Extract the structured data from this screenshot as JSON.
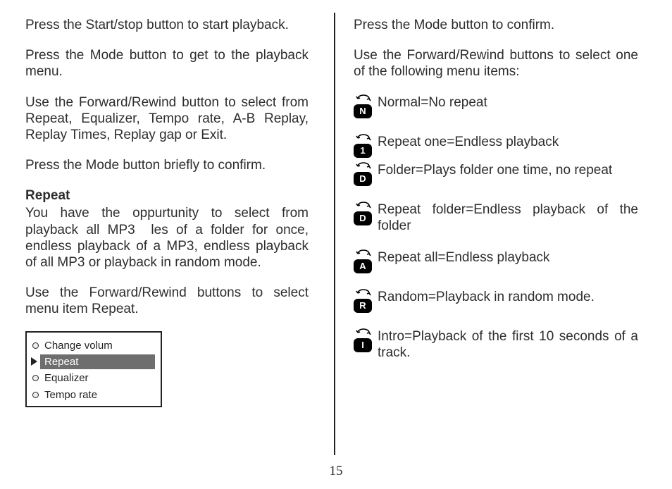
{
  "pageNumber": "15",
  "left": {
    "p1": "Press the Start/stop button to start playback.",
    "p2": "Press the Mode button to get to the playback menu.",
    "p3": "Use the Forward/Rewind button to select from Repeat, Equalizer, Tempo rate, A-B Replay, Replay Times, Replay gap or Exit.",
    "p4": "Press the Mode button briefly to confirm.",
    "heading": "Repeat",
    "p5": "You have the oppurtunity to select from playback all MP3  les of a folder for once, endless playback of a MP3, endless playback of all MP3 or playback in random mode.",
    "p6": "Use the Forward/Rewind buttons to select menu item Repeat.",
    "menu": {
      "item1": "Change volum",
      "item2": "Repeat",
      "item3": "Equalizer",
      "item4": "Tempo rate",
      "selectedIndex": 1
    }
  },
  "right": {
    "p1": "Press the Mode button to confirm.",
    "p2": "Use the Forward/Rewind buttons to select one of the following menu items:",
    "modes": [
      {
        "badge": "N",
        "text": "Normal=No repeat"
      },
      {
        "badge": "1",
        "text": "Repeat one=Endless playback"
      },
      {
        "badge": "D",
        "text": "Folder=Plays folder one time, no repeat"
      },
      {
        "badge": "D",
        "text": "Repeat folder=Endless playback of the folder"
      },
      {
        "badge": "A",
        "text": "Repeat all=Endless playback"
      },
      {
        "badge": "R",
        "text": "Random=Playback in random mode."
      },
      {
        "badge": "I",
        "text": "Intro=Playback of the first 10 seconds of a track."
      }
    ]
  }
}
